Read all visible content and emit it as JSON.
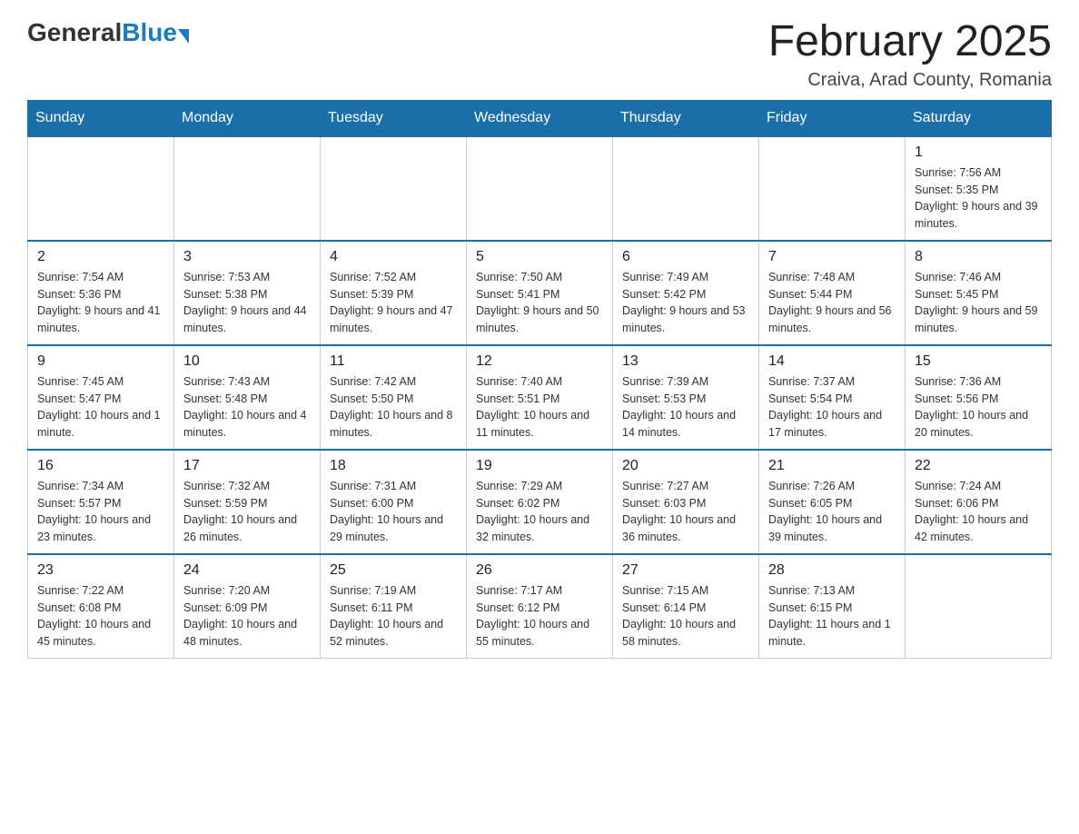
{
  "header": {
    "logo_general": "General",
    "logo_blue": "Blue",
    "month_title": "February 2025",
    "location": "Craiva, Arad County, Romania"
  },
  "days_of_week": [
    "Sunday",
    "Monday",
    "Tuesday",
    "Wednesday",
    "Thursday",
    "Friday",
    "Saturday"
  ],
  "weeks": [
    [
      {
        "day": "",
        "info": ""
      },
      {
        "day": "",
        "info": ""
      },
      {
        "day": "",
        "info": ""
      },
      {
        "day": "",
        "info": ""
      },
      {
        "day": "",
        "info": ""
      },
      {
        "day": "",
        "info": ""
      },
      {
        "day": "1",
        "info": "Sunrise: 7:56 AM\nSunset: 5:35 PM\nDaylight: 9 hours and 39 minutes."
      }
    ],
    [
      {
        "day": "2",
        "info": "Sunrise: 7:54 AM\nSunset: 5:36 PM\nDaylight: 9 hours and 41 minutes."
      },
      {
        "day": "3",
        "info": "Sunrise: 7:53 AM\nSunset: 5:38 PM\nDaylight: 9 hours and 44 minutes."
      },
      {
        "day": "4",
        "info": "Sunrise: 7:52 AM\nSunset: 5:39 PM\nDaylight: 9 hours and 47 minutes."
      },
      {
        "day": "5",
        "info": "Sunrise: 7:50 AM\nSunset: 5:41 PM\nDaylight: 9 hours and 50 minutes."
      },
      {
        "day": "6",
        "info": "Sunrise: 7:49 AM\nSunset: 5:42 PM\nDaylight: 9 hours and 53 minutes."
      },
      {
        "day": "7",
        "info": "Sunrise: 7:48 AM\nSunset: 5:44 PM\nDaylight: 9 hours and 56 minutes."
      },
      {
        "day": "8",
        "info": "Sunrise: 7:46 AM\nSunset: 5:45 PM\nDaylight: 9 hours and 59 minutes."
      }
    ],
    [
      {
        "day": "9",
        "info": "Sunrise: 7:45 AM\nSunset: 5:47 PM\nDaylight: 10 hours and 1 minute."
      },
      {
        "day": "10",
        "info": "Sunrise: 7:43 AM\nSunset: 5:48 PM\nDaylight: 10 hours and 4 minutes."
      },
      {
        "day": "11",
        "info": "Sunrise: 7:42 AM\nSunset: 5:50 PM\nDaylight: 10 hours and 8 minutes."
      },
      {
        "day": "12",
        "info": "Sunrise: 7:40 AM\nSunset: 5:51 PM\nDaylight: 10 hours and 11 minutes."
      },
      {
        "day": "13",
        "info": "Sunrise: 7:39 AM\nSunset: 5:53 PM\nDaylight: 10 hours and 14 minutes."
      },
      {
        "day": "14",
        "info": "Sunrise: 7:37 AM\nSunset: 5:54 PM\nDaylight: 10 hours and 17 minutes."
      },
      {
        "day": "15",
        "info": "Sunrise: 7:36 AM\nSunset: 5:56 PM\nDaylight: 10 hours and 20 minutes."
      }
    ],
    [
      {
        "day": "16",
        "info": "Sunrise: 7:34 AM\nSunset: 5:57 PM\nDaylight: 10 hours and 23 minutes."
      },
      {
        "day": "17",
        "info": "Sunrise: 7:32 AM\nSunset: 5:59 PM\nDaylight: 10 hours and 26 minutes."
      },
      {
        "day": "18",
        "info": "Sunrise: 7:31 AM\nSunset: 6:00 PM\nDaylight: 10 hours and 29 minutes."
      },
      {
        "day": "19",
        "info": "Sunrise: 7:29 AM\nSunset: 6:02 PM\nDaylight: 10 hours and 32 minutes."
      },
      {
        "day": "20",
        "info": "Sunrise: 7:27 AM\nSunset: 6:03 PM\nDaylight: 10 hours and 36 minutes."
      },
      {
        "day": "21",
        "info": "Sunrise: 7:26 AM\nSunset: 6:05 PM\nDaylight: 10 hours and 39 minutes."
      },
      {
        "day": "22",
        "info": "Sunrise: 7:24 AM\nSunset: 6:06 PM\nDaylight: 10 hours and 42 minutes."
      }
    ],
    [
      {
        "day": "23",
        "info": "Sunrise: 7:22 AM\nSunset: 6:08 PM\nDaylight: 10 hours and 45 minutes."
      },
      {
        "day": "24",
        "info": "Sunrise: 7:20 AM\nSunset: 6:09 PM\nDaylight: 10 hours and 48 minutes."
      },
      {
        "day": "25",
        "info": "Sunrise: 7:19 AM\nSunset: 6:11 PM\nDaylight: 10 hours and 52 minutes."
      },
      {
        "day": "26",
        "info": "Sunrise: 7:17 AM\nSunset: 6:12 PM\nDaylight: 10 hours and 55 minutes."
      },
      {
        "day": "27",
        "info": "Sunrise: 7:15 AM\nSunset: 6:14 PM\nDaylight: 10 hours and 58 minutes."
      },
      {
        "day": "28",
        "info": "Sunrise: 7:13 AM\nSunset: 6:15 PM\nDaylight: 11 hours and 1 minute."
      },
      {
        "day": "",
        "info": ""
      }
    ]
  ]
}
